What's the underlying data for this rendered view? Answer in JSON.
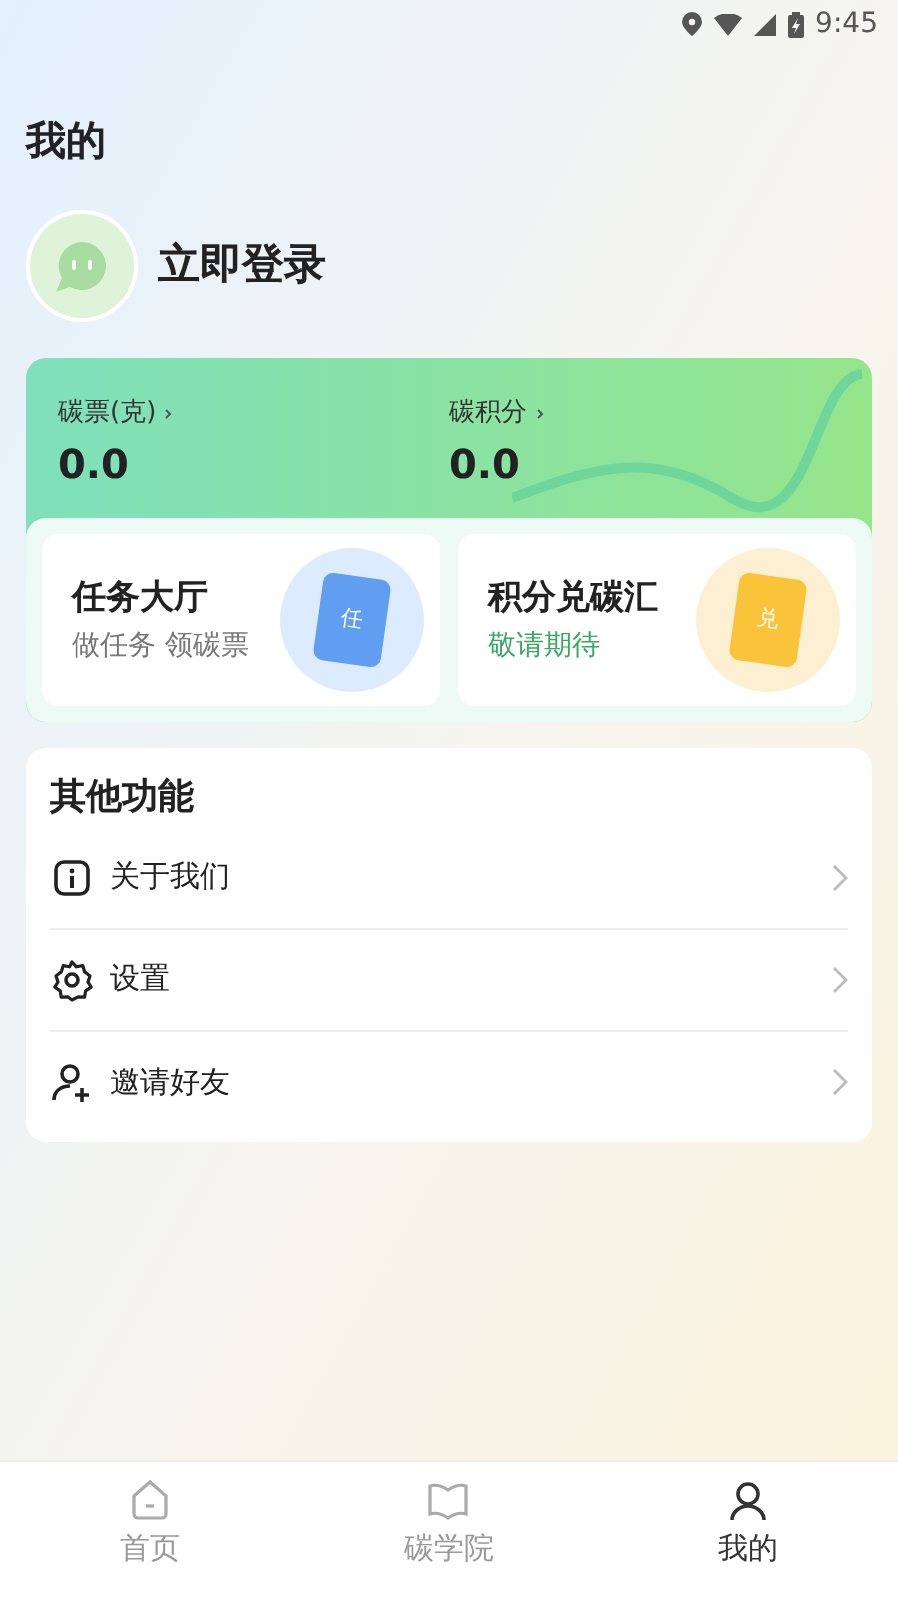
{
  "status_bar": {
    "time": "9:45"
  },
  "page_title": "我的",
  "profile": {
    "login_label": "立即登录"
  },
  "stats": [
    {
      "label": "碳票(克)",
      "value": "0.0"
    },
    {
      "label": "碳积分",
      "value": "0.0"
    }
  ],
  "feature_cards": [
    {
      "title": "任务大厅",
      "subtitle": "做任务 领碳票",
      "kind": "task",
      "badge_char": "任"
    },
    {
      "title": "积分兑碳汇",
      "subtitle": "敬请期待",
      "kind": "exchange",
      "badge_char": "兑"
    }
  ],
  "other_section": {
    "title": "其他功能",
    "items": [
      {
        "label": "关于我们",
        "kind": "info"
      },
      {
        "label": "设置",
        "kind": "settings"
      },
      {
        "label": "邀请好友",
        "kind": "invite"
      }
    ]
  },
  "tab_bar": [
    {
      "label": "首页",
      "kind": "home",
      "selected": false
    },
    {
      "label": "碳学院",
      "kind": "academy",
      "selected": false
    },
    {
      "label": "我的",
      "kind": "me",
      "selected": true
    }
  ]
}
